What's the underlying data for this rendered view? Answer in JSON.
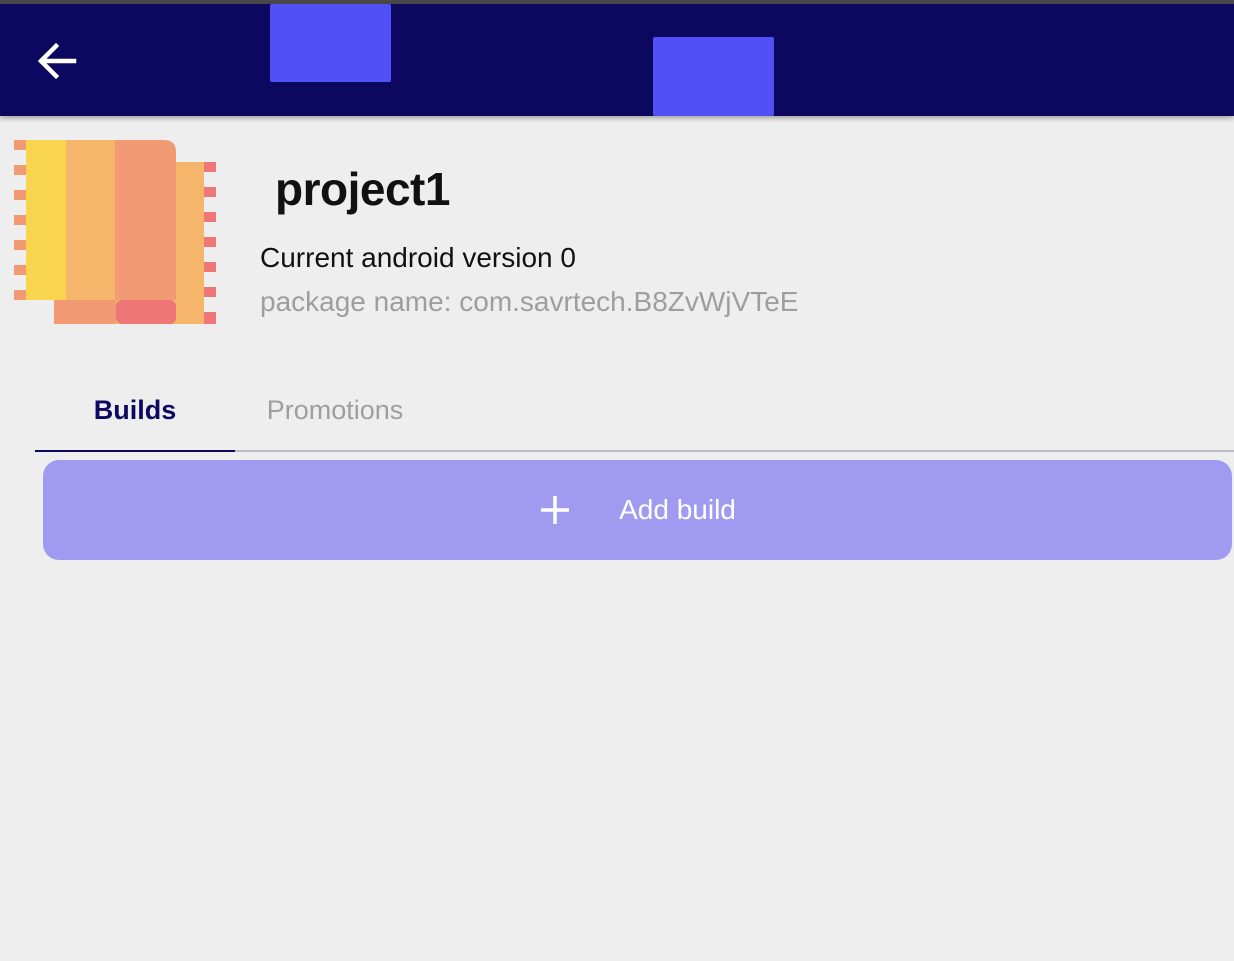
{
  "appbar": {
    "back_icon": "arrow-left-icon",
    "background": "#0c0860",
    "accent_blocks_color": "#5150f7"
  },
  "project": {
    "icon": "project-book-icon",
    "title": "project1",
    "version_text": "Current android version 0",
    "package_text": "package name: com.savrtech.B8ZvWjVTeE"
  },
  "tabs": [
    {
      "label": "Builds",
      "selected": true
    },
    {
      "label": "Promotions",
      "selected": false
    }
  ],
  "add_build": {
    "icon": "plus-icon",
    "label": "Add build",
    "color": "#a09bf1"
  }
}
